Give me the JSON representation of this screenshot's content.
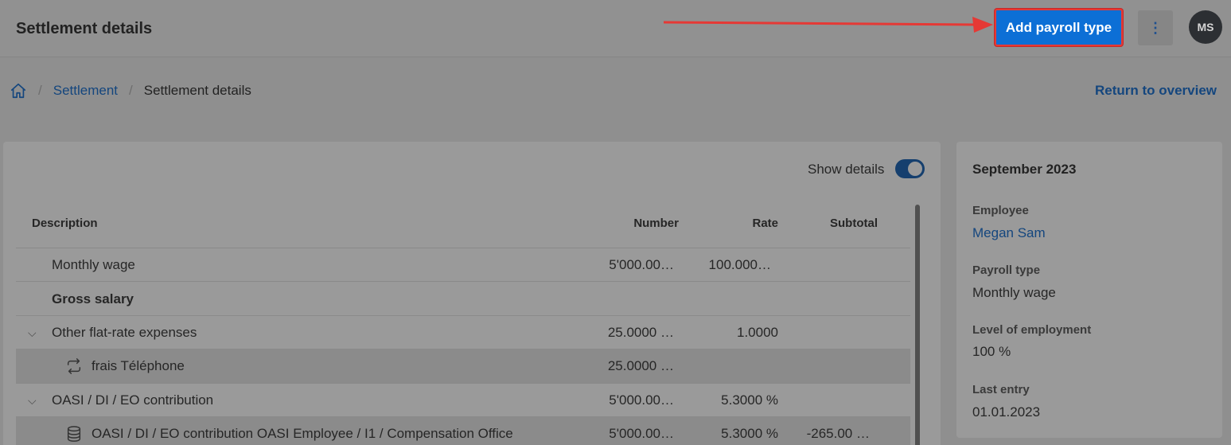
{
  "header": {
    "title": "Settlement details",
    "add_button": "Add payroll type",
    "menu_icon": "more-vertical-icon",
    "avatar_initials": "MS"
  },
  "breadcrumb": {
    "home_icon": "home-icon",
    "items": [
      "Settlement",
      "Settlement details"
    ],
    "separator": "/"
  },
  "return_link": "Return to overview",
  "details": {
    "toggle_label": "Show details",
    "toggle_on": true
  },
  "table": {
    "columns": [
      "Description",
      "Number",
      "Rate",
      "Subtotal"
    ],
    "rows": [
      {
        "description": "Monthly wage",
        "number": "5'000.00…",
        "rate": "100.000…",
        "subtotal": ""
      },
      {
        "description": "Gross salary",
        "number": "",
        "rate": "",
        "subtotal": ""
      },
      {
        "description": "Other flat-rate expenses",
        "number": "25.0000 …",
        "rate": "1.0000",
        "subtotal": ""
      },
      {
        "description": "frais Téléphone",
        "number": "25.0000 …",
        "rate": "",
        "subtotal": "",
        "icon": "repeat-icon"
      },
      {
        "description": "OASI / DI / EO contribution",
        "number": "5'000.00…",
        "rate": "5.3000 %",
        "subtotal": ""
      },
      {
        "description": "OASI / DI / EO contribution OASI Employee / I1 / Compensation Office",
        "number": "5'000.00…",
        "rate": "5.3000 %",
        "subtotal": "-265.00 …",
        "icon": "database-icon"
      }
    ]
  },
  "summary": {
    "title": "September 2023",
    "fields": [
      {
        "label": "Employee",
        "value": "Megan Sam"
      },
      {
        "label": "Payroll type",
        "value": "Monthly wage"
      },
      {
        "label": "Level of employment",
        "value": "100 %"
      },
      {
        "label": "Last entry",
        "value": "01.01.2023"
      }
    ]
  },
  "colors": {
    "primary": "#0c6fd6",
    "link": "#14467e",
    "annotation": "#e53935"
  }
}
